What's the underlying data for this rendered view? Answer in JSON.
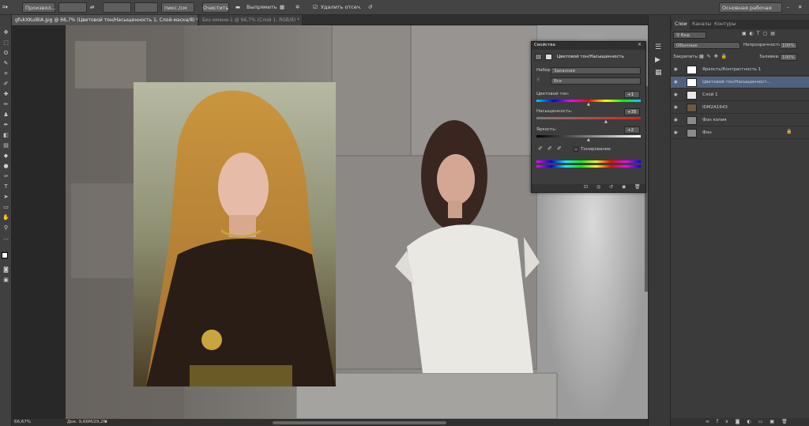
{
  "options_bar": {
    "sample_size": "Произвол...",
    "units": "пикс./см",
    "clear_label": "Очистить",
    "straighten_label": "Выпрямить",
    "delete_cropped_label": "Удалить отсеч. пикс.",
    "workspace_label": "Основная рабочая среда"
  },
  "tabs": [
    {
      "label": "gfukXKuIBiA.jpg @ 66,7% (Цветовой тон/Насыщенность 1, Слой-маска/8) *"
    },
    {
      "label": "Без имени-1 @ 66,7% (Слой 1, RGB/8) *"
    }
  ],
  "status": {
    "zoom": "66,67%",
    "doc": "Док: 9,66M/29,2M"
  },
  "properties": {
    "tab_label": "Свойства",
    "title": "Цветовой тон/Насыщенность",
    "preset_label": "Набор:",
    "preset_value": "Заказная",
    "channel_value": "Все",
    "hue_label": "Цветовой тон:",
    "hue_value": "+1",
    "sat_label": "Насыщенность:",
    "sat_value": "+35",
    "light_label": "Яркость:",
    "light_value": "+2",
    "colorize_label": "Тонирование"
  },
  "layers": {
    "tabs": [
      "Слои",
      "Каналы",
      "Контуры"
    ],
    "kind_label": "Вид",
    "blend_mode": "Обычные",
    "opacity_label": "Непрозрачность:",
    "opacity_value": "100%",
    "lock_label": "Закрепить:",
    "fill_label": "Заливка:",
    "fill_value": "100%",
    "items": [
      {
        "name": "Яркость/Контрастность 1",
        "thumb": "#ffffff",
        "selected": false
      },
      {
        "name": "Цветовой тон/Насыщенност...",
        "thumb": "#ffffff",
        "selected": true
      },
      {
        "name": "Слой 1",
        "thumb": "#e8e8e8",
        "selected": false
      },
      {
        "name": "IDM2A1643",
        "thumb": "#6a5a40",
        "selected": false
      },
      {
        "name": "Фон копия",
        "thumb": "#8a8a8a",
        "selected": false
      },
      {
        "name": "Фон",
        "thumb": "#8a8a8a",
        "selected": false
      }
    ]
  },
  "colors": {
    "accent": "#4b5e7a",
    "selected_row": "#50617e"
  }
}
